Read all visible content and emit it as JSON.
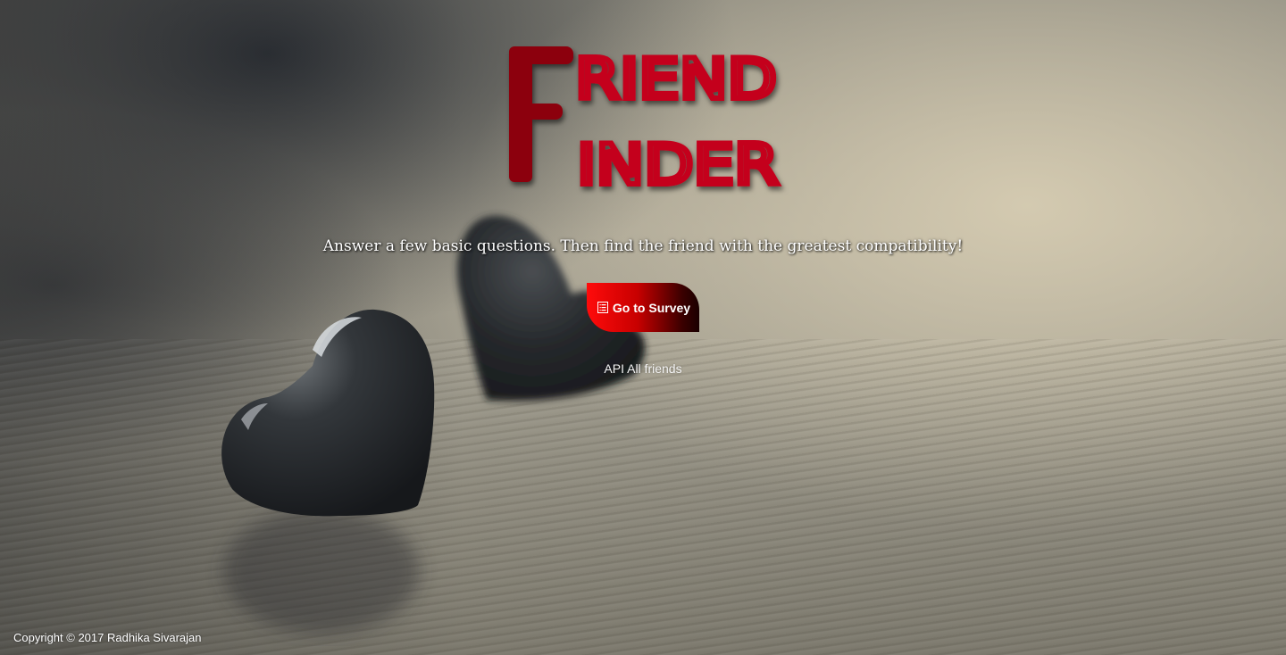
{
  "logo": {
    "line1_initial": "F",
    "line1_rest": "RIEND",
    "line2_rest": "INDER",
    "color": "#c4001c",
    "initial_color": "#8c0010"
  },
  "tagline": "Answer a few basic questions. Then find the friend with the greatest compatibility!",
  "survey_button": {
    "icon": "list-alt-icon",
    "label": "Go to Survey",
    "gradient_start": "#ff0b0b",
    "gradient_end": "#1a0000"
  },
  "api_link": "API All friends",
  "footer": "Copyright © 2017 Radhika Sivarajan"
}
